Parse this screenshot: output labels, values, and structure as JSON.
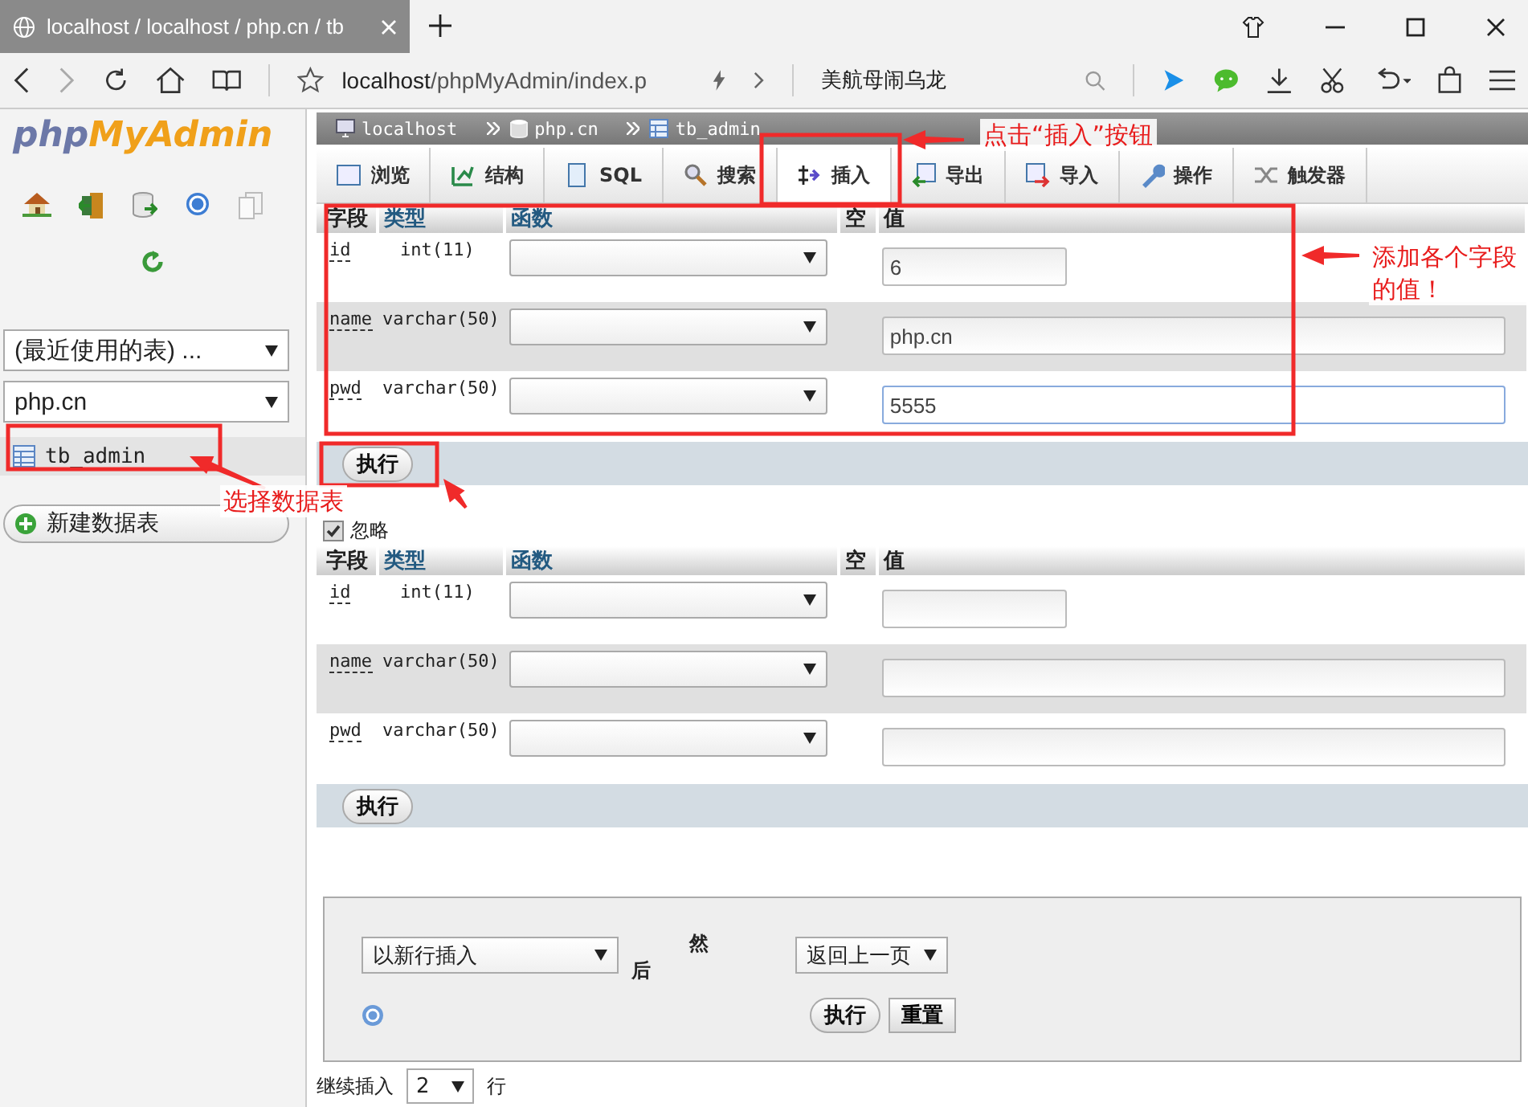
{
  "browser": {
    "tab_title": "localhost / localhost / php.cn / tb",
    "address_host": "localhost",
    "address_path": "/phpMyAdmin/index.p",
    "search": "美航母闹乌龙"
  },
  "sidebar": {
    "logo_left": "php",
    "logo_right": "MyAdmin",
    "recent": "(最近使用的表) ...",
    "database": "php.cn",
    "tables": [
      {
        "name": "tb_admin",
        "selected": true
      }
    ],
    "new_table": "新建数据表"
  },
  "breadcrumb": [
    "localhost",
    "php.cn",
    "tb_admin"
  ],
  "tabs": [
    {
      "label": "浏览",
      "selected": false
    },
    {
      "label": "结构",
      "selected": false
    },
    {
      "label": "SQL",
      "selected": false
    },
    {
      "label": "搜索",
      "selected": false
    },
    {
      "label": "插入",
      "selected": true
    },
    {
      "label": "导出",
      "selected": false
    },
    {
      "label": "导入",
      "selected": false
    },
    {
      "label": "操作",
      "selected": false
    },
    {
      "label": "触发器",
      "selected": false
    }
  ],
  "insert_forms": [
    {
      "columns": [
        "字段",
        "类型",
        "函数",
        "空",
        "值"
      ],
      "rows": [
        {
          "field": "id",
          "type": "int(11)",
          "value": "6",
          "focused": false
        },
        {
          "field": "name",
          "type": "varchar(50)",
          "value": "php.cn",
          "focused": false
        },
        {
          "field": "pwd",
          "type": "varchar(50)",
          "value": "5555",
          "focused": true
        }
      ],
      "submit": "执行"
    },
    {
      "ignore": {
        "label": "忽略",
        "checked": true
      },
      "columns": [
        "字段",
        "类型",
        "函数",
        "空",
        "值"
      ],
      "rows": [
        {
          "field": "id",
          "type": "int(11)",
          "focused": false
        },
        {
          "field": "name",
          "type": "varchar(50)",
          "focused": false
        },
        {
          "field": "pwd",
          "type": "varchar(50)",
          "focused": false
        }
      ],
      "submit": "执行"
    }
  ],
  "footer": {
    "insert_mode": "以新行插入",
    "after": "后",
    "then": "然",
    "next_action": "返回上一页",
    "submit": "执行",
    "reset": "重置",
    "continue_label": "继续插入",
    "continue_count": "2",
    "rows_label": "行"
  },
  "annotations": [
    {
      "text": "点击“插入”按钮"
    },
    {
      "text": "添加各个字段的值！"
    },
    {
      "text": "选择数据表"
    }
  ]
}
